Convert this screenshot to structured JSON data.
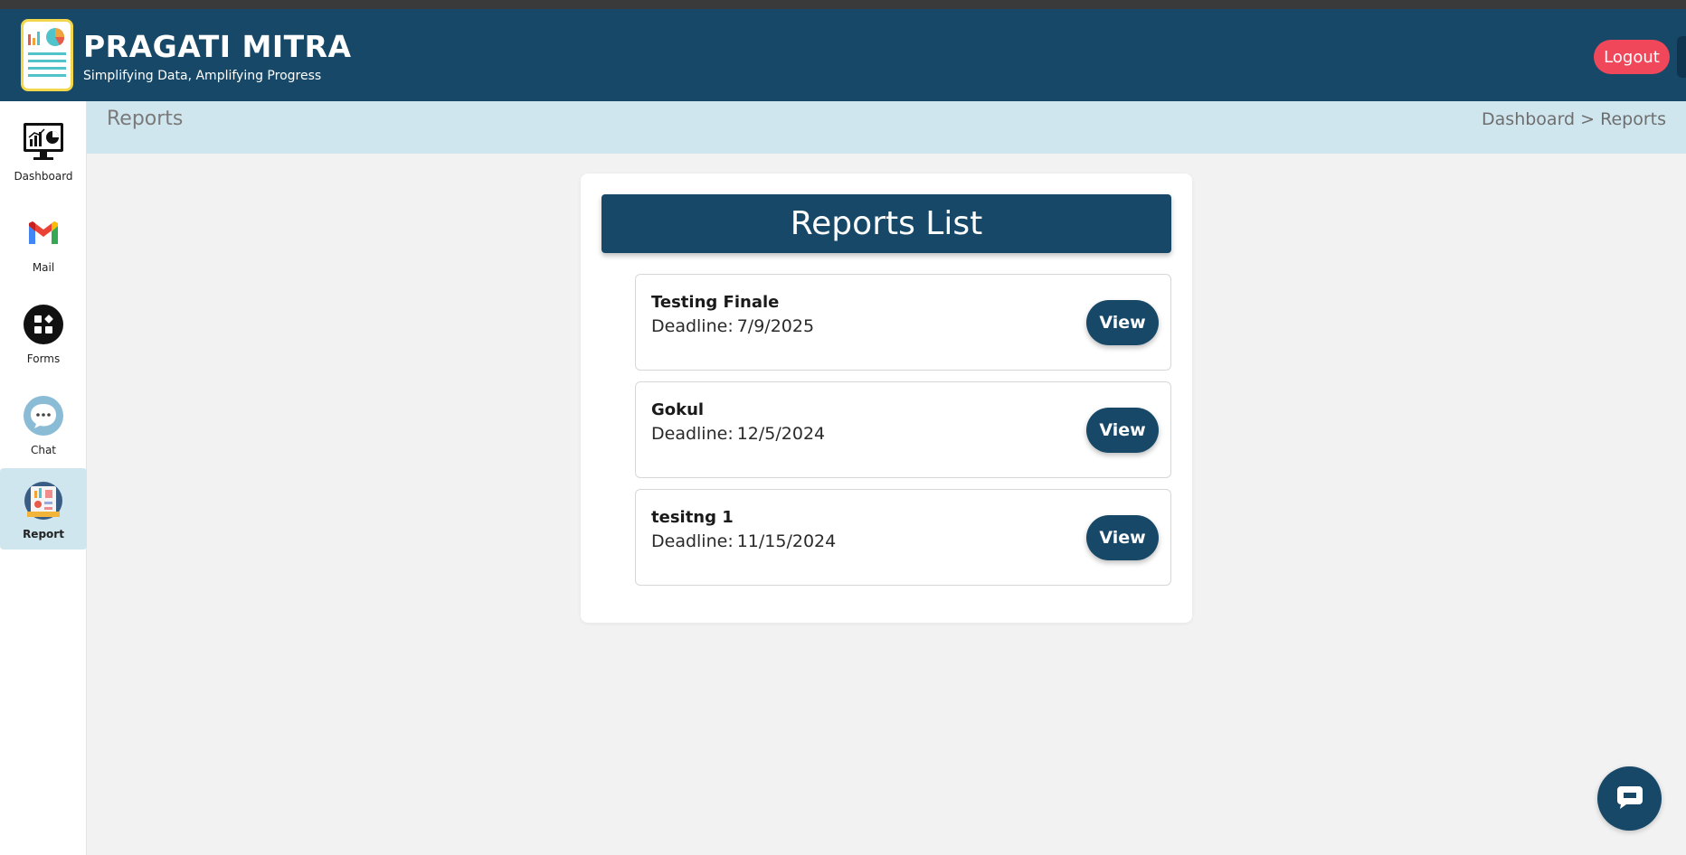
{
  "header": {
    "title": "PRAGATI MITRA",
    "subtitle": "Simplifying Data, Amplifying Progress",
    "logout_label": "Logout"
  },
  "sidebar": {
    "items": [
      {
        "label": "Dashboard",
        "icon": "dashboard-icon"
      },
      {
        "label": "Mail",
        "icon": "mail-icon"
      },
      {
        "label": "Forms",
        "icon": "forms-icon"
      },
      {
        "label": "Chat",
        "icon": "chat-icon"
      },
      {
        "label": "Report",
        "icon": "report-icon",
        "active": true
      }
    ]
  },
  "breadcrumb": {
    "title": "Reports",
    "path": "Dashboard > Reports"
  },
  "reports_list": {
    "heading": "Reports List",
    "deadline_label": "Deadline:",
    "view_label": "View",
    "items": [
      {
        "name": "Testing Finale",
        "deadline": "7/9/2025"
      },
      {
        "name": "Gokul",
        "deadline": "12/5/2024"
      },
      {
        "name": "tesitng 1",
        "deadline": "11/15/2024"
      }
    ]
  },
  "colors": {
    "primary": "#174867",
    "logout": "#f0475a",
    "crumb_bg": "#d0e6ef",
    "page_bg": "#f2f2f2"
  }
}
